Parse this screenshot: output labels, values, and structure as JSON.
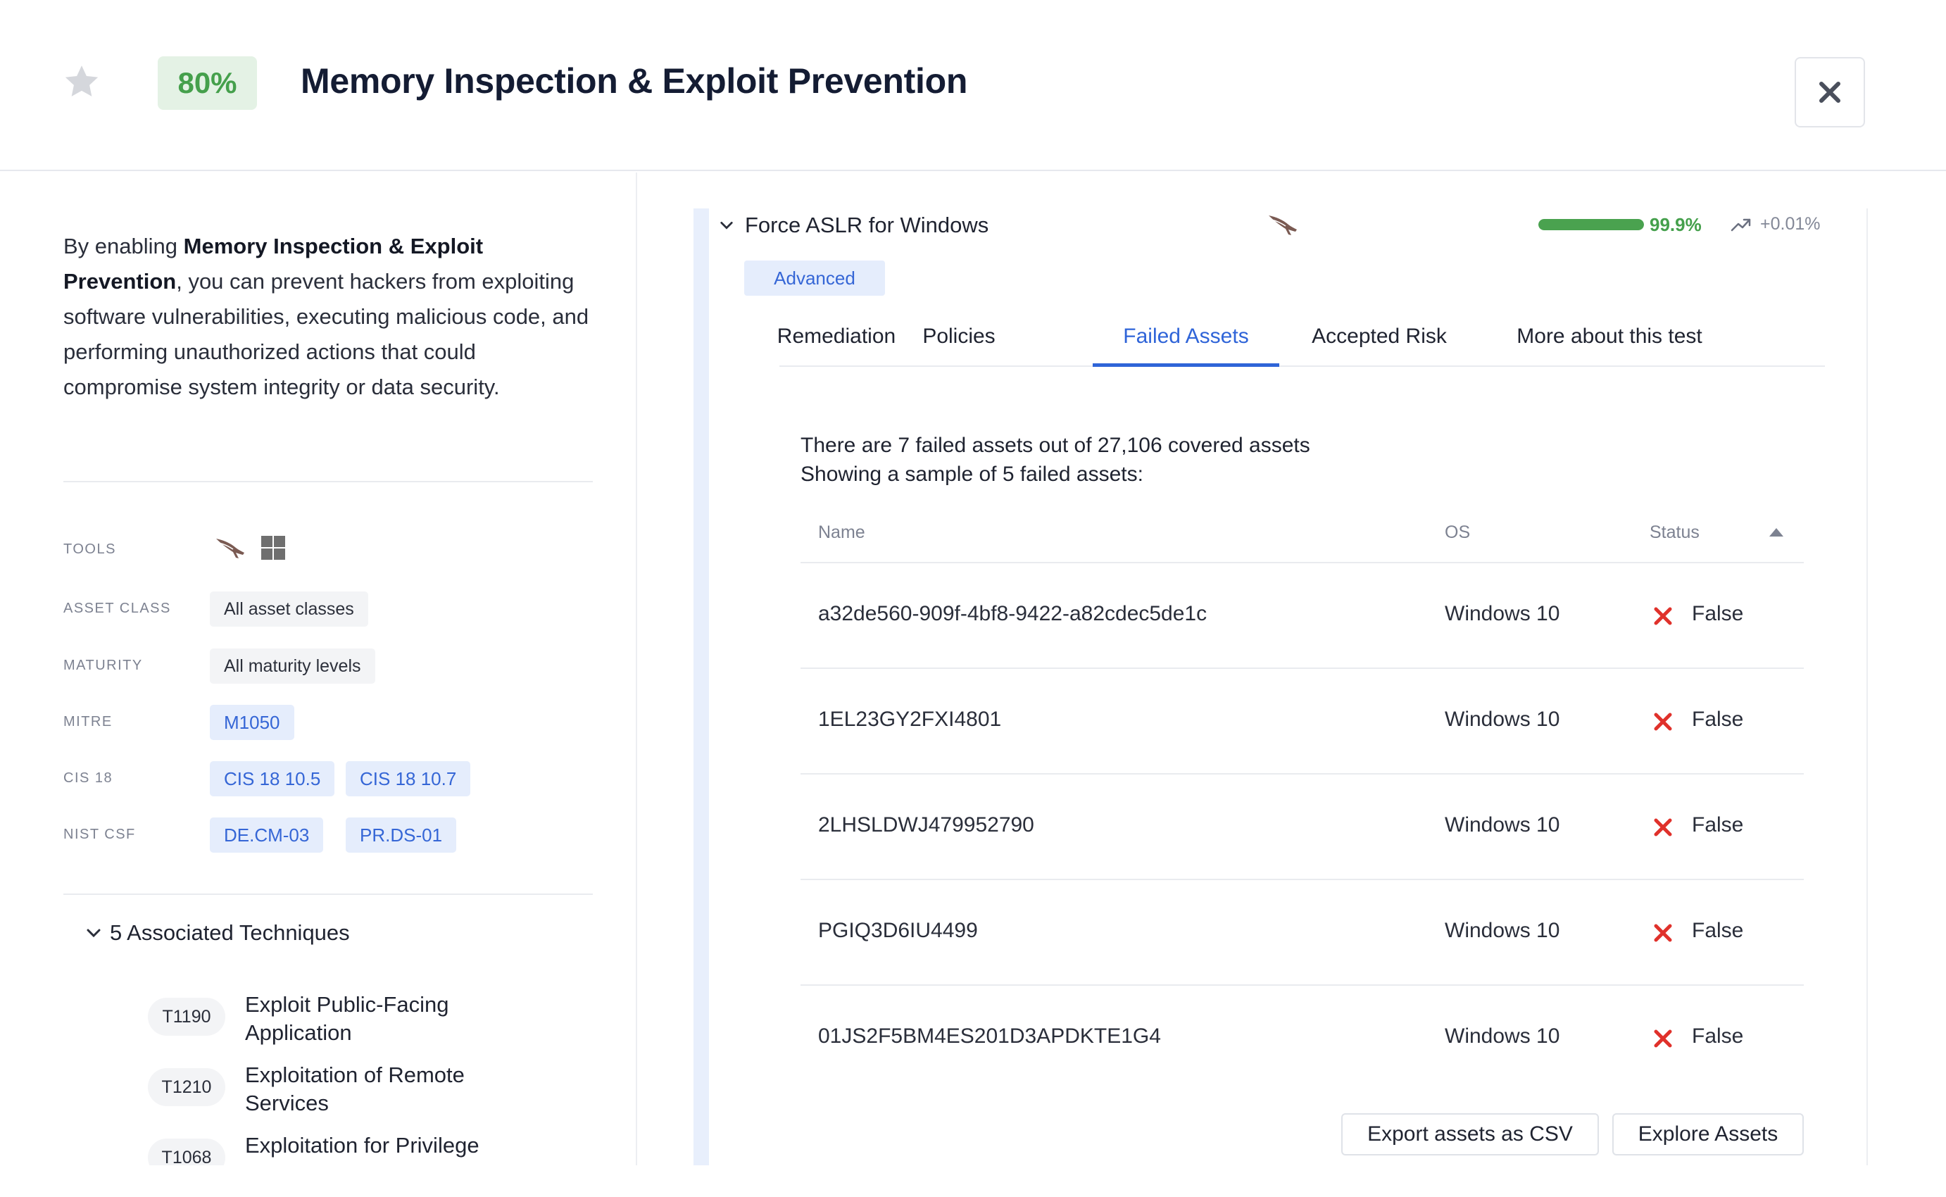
{
  "header": {
    "score": "80%",
    "title": "Memory Inspection & Exploit Prevention"
  },
  "left": {
    "description_bold_1": "Memory Inspection & Exploit Prevention",
    "description_pre": "By enabling ",
    "description_post": ", you can prevent hackers from exploiting software vulnerabilities, executing malicious code, and performing unauthorized actions that could compromise system integrity or data security.",
    "meta": {
      "tools_label": "TOOLS",
      "asset_class_label": "ASSET CLASS",
      "asset_class_value": "All asset classes",
      "maturity_label": "MATURITY",
      "maturity_value": "All maturity levels",
      "mitre_label": "MITRE",
      "mitre_values": [
        "M1050"
      ],
      "cis_label": "CIS 18",
      "cis_values": [
        "CIS 18 10.5",
        "CIS 18 10.7"
      ],
      "nist_label": "NIST CSF",
      "nist_values": [
        "DE.CM-03",
        "PR.DS-01"
      ]
    },
    "associated_title": "5 Associated Techniques",
    "techniques": [
      {
        "id": "T1190",
        "name": "Exploit Public-Facing Application"
      },
      {
        "id": "T1210",
        "name": "Exploitation of Remote Services"
      },
      {
        "id": "T1068",
        "name": "Exploitation for Privilege"
      }
    ]
  },
  "test": {
    "name": "Force ASLR for Windows",
    "progress_value": 0.999,
    "progress_label": "99.9%",
    "trend_label": "+0.01%",
    "badge": "Advanced",
    "tabs": [
      "Remediation",
      "Policies",
      "Failed Assets",
      "Accepted Risk",
      "More about this test"
    ],
    "active_tab": "Failed Assets",
    "summary_line1": "There are 7 failed assets out of 27,106 covered assets",
    "summary_line2": "Showing a sample of 5 failed assets:",
    "columns": [
      "Name",
      "OS",
      "Status"
    ],
    "rows": [
      {
        "name": "a32de560-909f-4bf8-9422-a82cdec5de1c",
        "os": "Windows 10",
        "status": "False"
      },
      {
        "name": "1EL23GY2FXI4801",
        "os": "Windows 10",
        "status": "False"
      },
      {
        "name": "2LHSLDWJ479952790",
        "os": "Windows 10",
        "status": "False"
      },
      {
        "name": "PGIQ3D6IU4499",
        "os": "Windows 10",
        "status": "False"
      },
      {
        "name": "01JS2F5BM4ES201D3APDKTE1G4",
        "os": "Windows 10",
        "status": "False"
      }
    ],
    "export_button": "Export assets as CSV",
    "explore_button": "Explore Assets"
  },
  "colors": {
    "accent": "#2f64d8",
    "success": "#45a04c",
    "danger": "#e0312b"
  },
  "icons": {
    "favorite": "star-icon",
    "close": "close-icon",
    "vendor": "falcon-icon",
    "os": "windows-icon",
    "trend": "trend-up-icon",
    "status_fail": "x-mark-icon",
    "sort": "sort-asc-icon"
  }
}
